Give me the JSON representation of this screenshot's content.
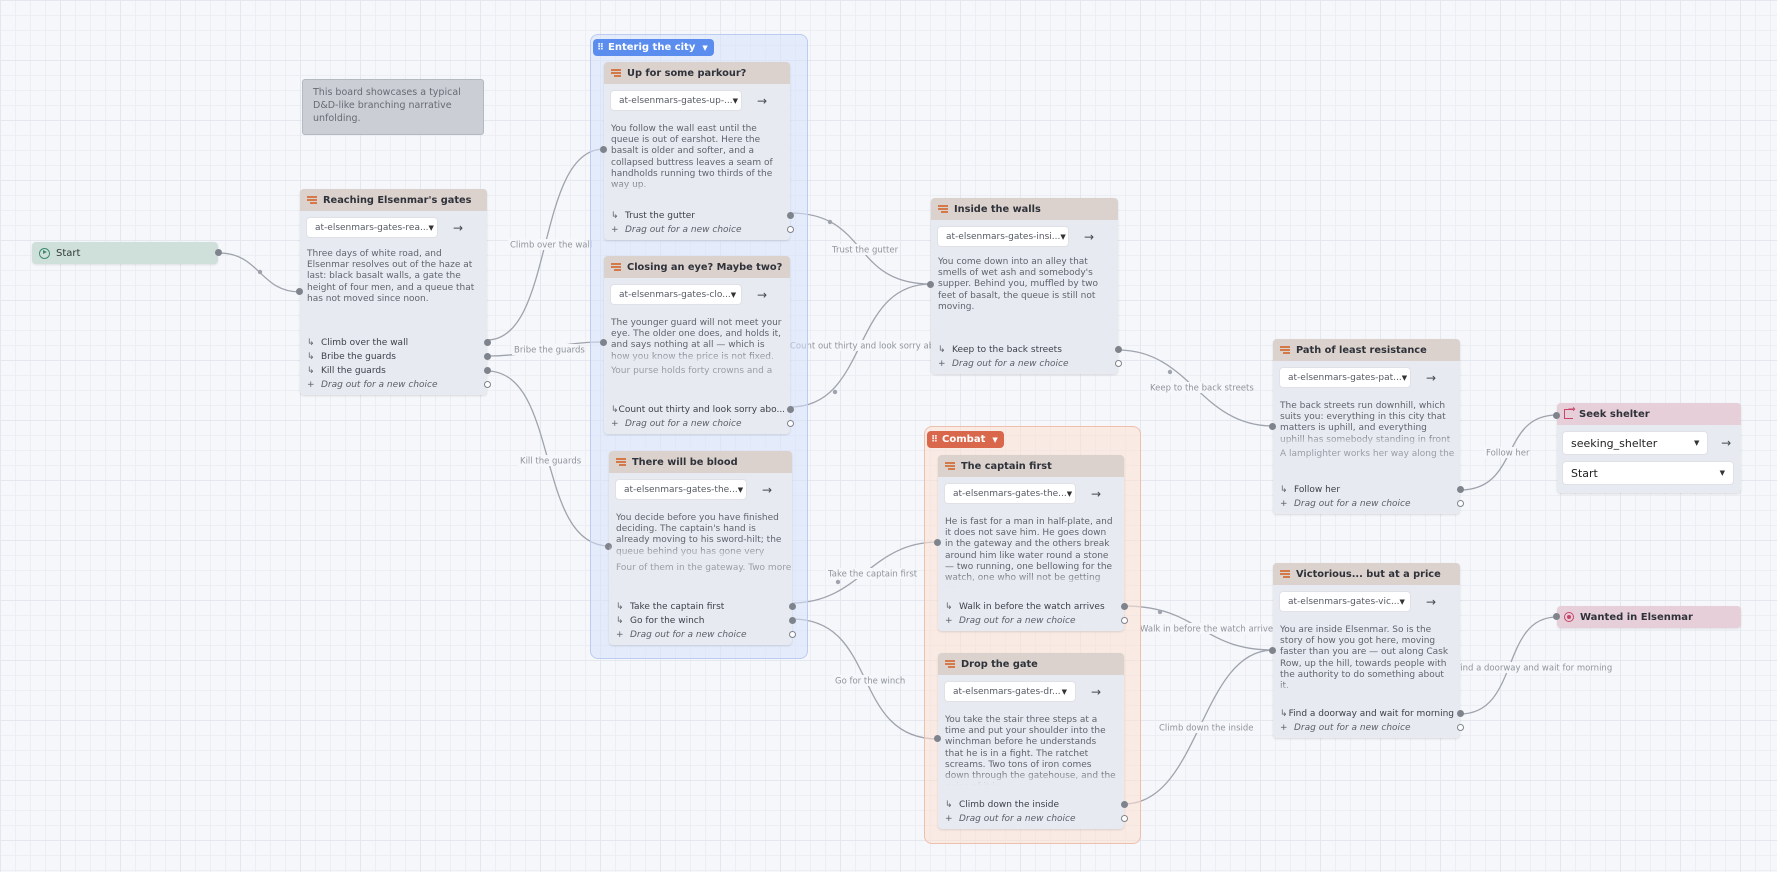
{
  "note": "This board showcases a typical D&D-like branching narrative unfolding.",
  "start": {
    "label": "Start"
  },
  "groups": {
    "city": "Enterig the city",
    "combat": "Combat"
  },
  "placeholder_choice": "Drag out for a new choice",
  "nodes": {
    "gates": {
      "title": "Reaching Elsenmar's gates",
      "id": "at-elsenmars-gates-rea...",
      "text": "Three days of white road, and Elsenmar resolves out of the haze at last: black basalt walls, a gate the height of four men, and a queue that has not moved since noon.",
      "choices": [
        "Climb over the wall",
        "Bribe the guards",
        "Kill the guards"
      ]
    },
    "parkour": {
      "title": "Up for some parkour?",
      "id": "at-elsenmars-gates-up-...",
      "text": "You follow the wall east until the queue is out of earshot. Here the basalt is older and softer, and a collapsed buttress leaves a seam of handholds running two thirds of the way up.",
      "choices": [
        "Trust the gutter"
      ]
    },
    "closing": {
      "title": "Closing an eye? Maybe two?",
      "id": "at-elsenmars-gates-clo...",
      "text": "The younger guard will not meet your eye. The older one does, and holds it, and says nothing at all — which is how you know the price is not fixed.",
      "text2": "Your purse holds forty crowns and a",
      "choices": [
        "Count out thirty and look sorry abo..."
      ]
    },
    "blood": {
      "title": "There will be blood",
      "id": "at-elsenmars-gates-the...",
      "text": "You decide before you have finished deciding. The captain's hand is already moving to his sword-hilt; the queue behind you has gone very quiet.",
      "text2": "Four of them in the gateway. Two more",
      "choices": [
        "Take the captain first",
        "Go for the winch"
      ]
    },
    "inside": {
      "title": "Inside the walls",
      "id": "at-elsenmars-gates-insi...",
      "text": "You come down into an alley that smells of wet ash and somebody's supper. Behind you, muffled by two feet of basalt, the queue is still not moving.",
      "choices": [
        "Keep to the back streets"
      ]
    },
    "captain": {
      "title": "The captain first",
      "id": "at-elsenmars-gates-the...",
      "text": "He is fast for a man in half-plate, and it does not save him. He goes down in the gateway and the others break around him like water round a stone — two running, one bellowing for the watch, one who will not be getting up.",
      "choices": [
        "Walk in before the watch arrives"
      ]
    },
    "drop": {
      "title": "Drop the gate",
      "id": "at-elsenmars-gates-dr...",
      "text": "You take the stair three steps at a time and put your shoulder into the winchman before he understands that he is in a fight. The ratchet screams. Two tons of iron comes down through the gatehouse, and the noise of it is",
      "choices": [
        "Climb down the inside"
      ]
    },
    "path": {
      "title": "Path of least resistance",
      "id": "at-elsenmars-gates-pat...",
      "text": "The back streets run downhill, which suits you: everything in this city that matters is uphill, and everything uphill has somebody standing in front of it.",
      "text2": "A lamplighter works her way along the",
      "choices": [
        "Follow her"
      ]
    },
    "victorious": {
      "title": "Victorious... but at a price",
      "id": "at-elsenmars-gates-vic...",
      "text": "You are inside Elsenmar. So is the story of how you got here, moving faster than you are — out along Cask Row, up the hill, towards people with the authority to do something about it.",
      "choices": [
        "Find a doorway and wait for morning"
      ]
    }
  },
  "seek": {
    "title": "Seek shelter",
    "target": "seeking_shelter",
    "entry": "Start"
  },
  "wanted": {
    "title": "Wanted in Elsenmar"
  },
  "edge_labels": {
    "climb": "Climb over the wall",
    "bribe": "Bribe the guards",
    "kill": "Kill the guards",
    "gutter": "Trust the gutter",
    "count": "Count out thirty and look sorry about it",
    "back": "Keep to the back streets",
    "follow": "Follow her",
    "captain": "Take the captain first",
    "winch": "Go for the winch",
    "walk": "Walk in before the watch arrives",
    "climbdown": "Climb down the inside",
    "doorway": "Find a doorway and wait for morning"
  }
}
